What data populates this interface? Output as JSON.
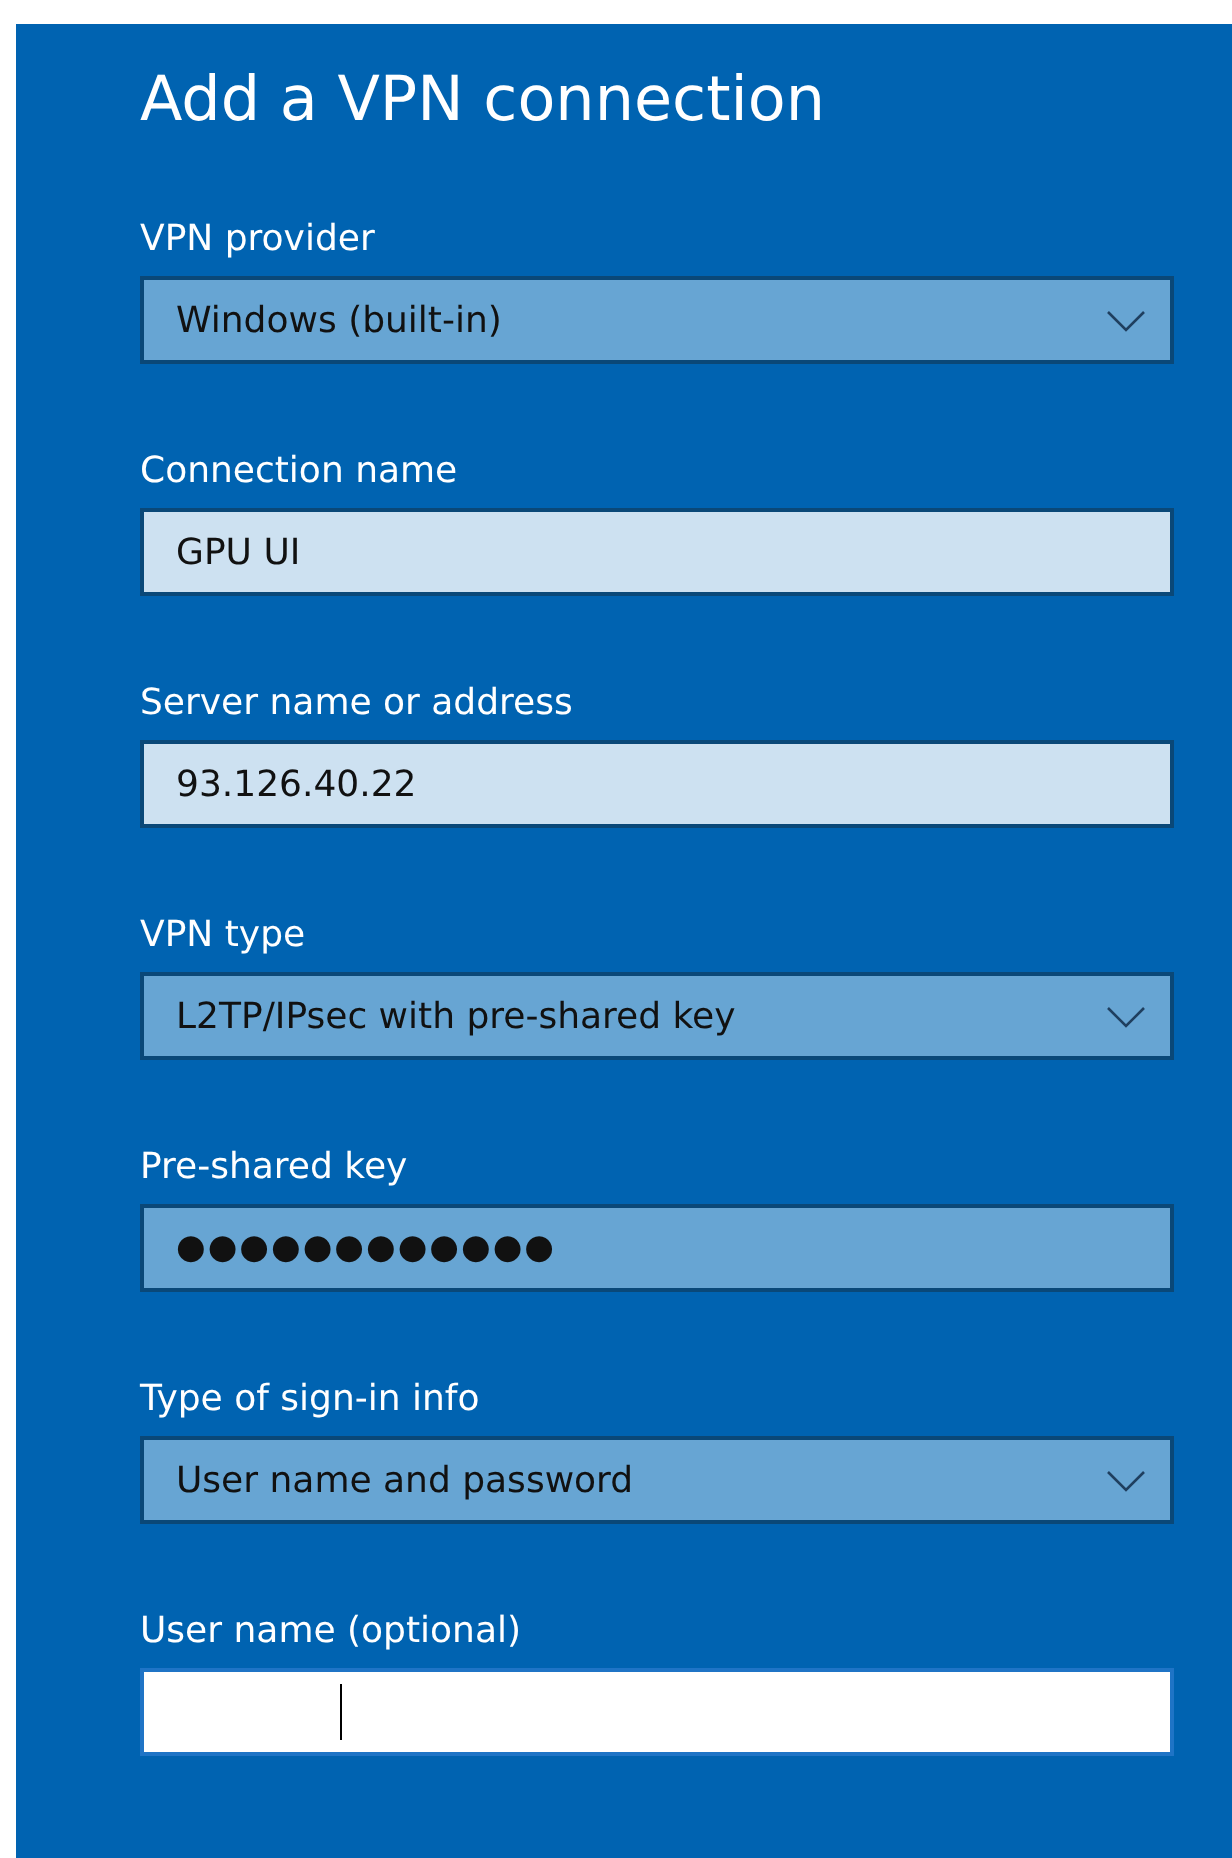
{
  "dialog": {
    "title": "Add a VPN connection",
    "fields": [
      {
        "label": "VPN provider",
        "kind": "dropdown",
        "value": "Windows (built-in)",
        "focused": false
      },
      {
        "label": "Connection name",
        "kind": "text",
        "value": "GPU UI",
        "focused": false
      },
      {
        "label": "Server name or address",
        "kind": "text",
        "value": "93.126.40.22",
        "focused": false
      },
      {
        "label": "VPN type",
        "kind": "dropdown",
        "value": "L2TP/IPsec with pre-shared key",
        "focused": false
      },
      {
        "label": "Pre-shared key",
        "kind": "password",
        "value": "●●●●●●●●●●●●",
        "focused": false
      },
      {
        "label": "Type of sign-in info",
        "kind": "dropdown",
        "value": "User name and password",
        "focused": false
      },
      {
        "label": "User name (optional)",
        "kind": "text",
        "focused": true
      }
    ]
  }
}
